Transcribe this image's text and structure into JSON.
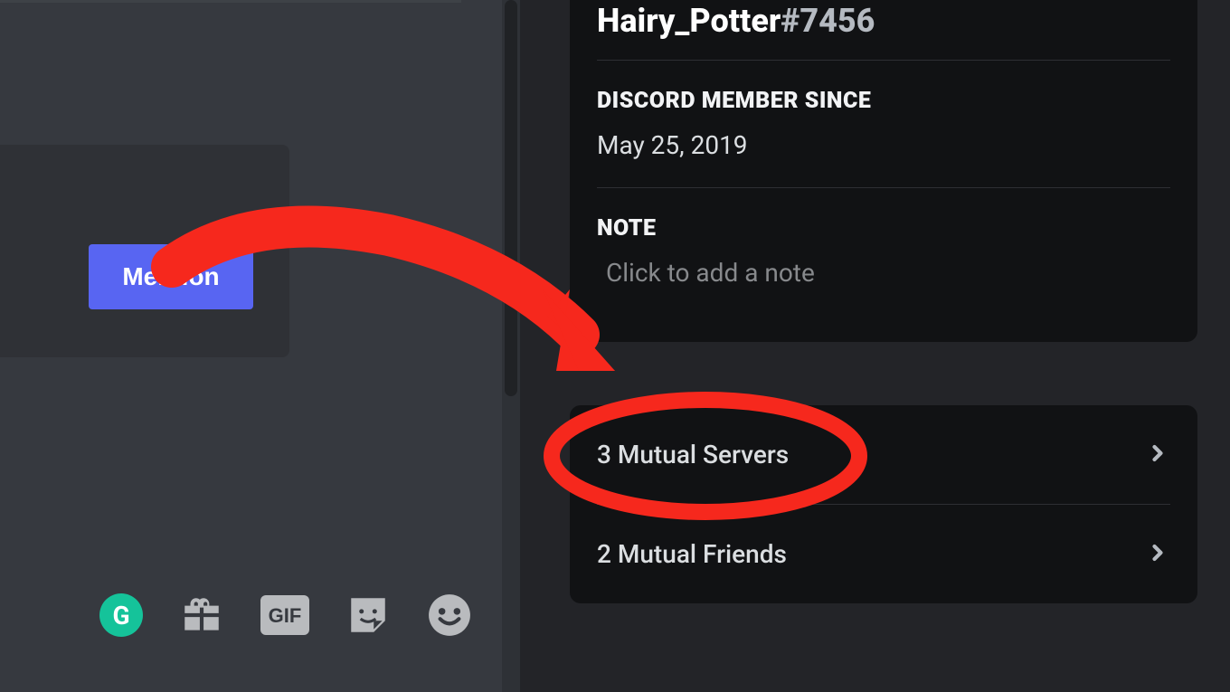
{
  "profile": {
    "username": "Hairy_Potter",
    "discriminator": "#7456",
    "member_since_label": "DISCORD MEMBER SINCE",
    "member_since_value": "May 25, 2019",
    "note_label": "NOTE",
    "note_placeholder": "Click to add a note"
  },
  "mutual": {
    "servers_label": "3 Mutual Servers",
    "friends_label": "2 Mutual Friends"
  },
  "actions": {
    "mention_label": "Mention"
  },
  "toolbar": {
    "grammarly": "G",
    "gift": "gift-icon",
    "gif": "GIF",
    "sticker": "sticker-icon",
    "emoji": "emoji-icon"
  }
}
